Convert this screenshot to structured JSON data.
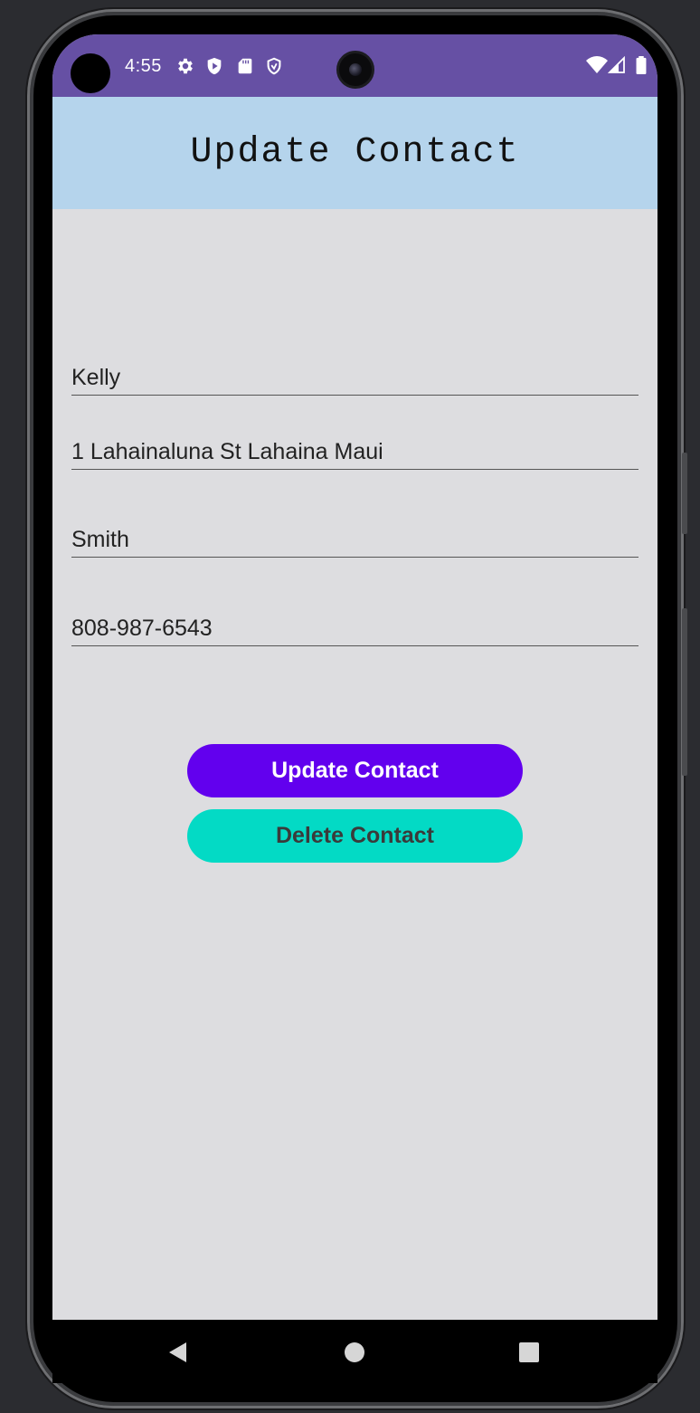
{
  "status_bar": {
    "time": "4:55",
    "bg_color": "#6650a4",
    "left_icons": [
      "settings-icon",
      "shield-play-icon",
      "sd-card-icon",
      "shield-outline-icon"
    ],
    "right_icons": [
      "wifi-icon",
      "cell-signal-icon",
      "battery-icon"
    ]
  },
  "header": {
    "title": "Update Contact",
    "bg_color": "#b5d4ec"
  },
  "form": {
    "first_name": "Kelly",
    "address": "1 Lahainaluna St Lahaina Maui",
    "last_name": "Smith",
    "phone": "808-987-6543"
  },
  "actions": {
    "update_label": "Update Contact",
    "delete_label": "Delete Contact",
    "update_color": "#6200ee",
    "delete_color": "#03dac5"
  },
  "nav": {
    "icons": [
      "back-icon",
      "home-icon",
      "recents-icon"
    ]
  }
}
